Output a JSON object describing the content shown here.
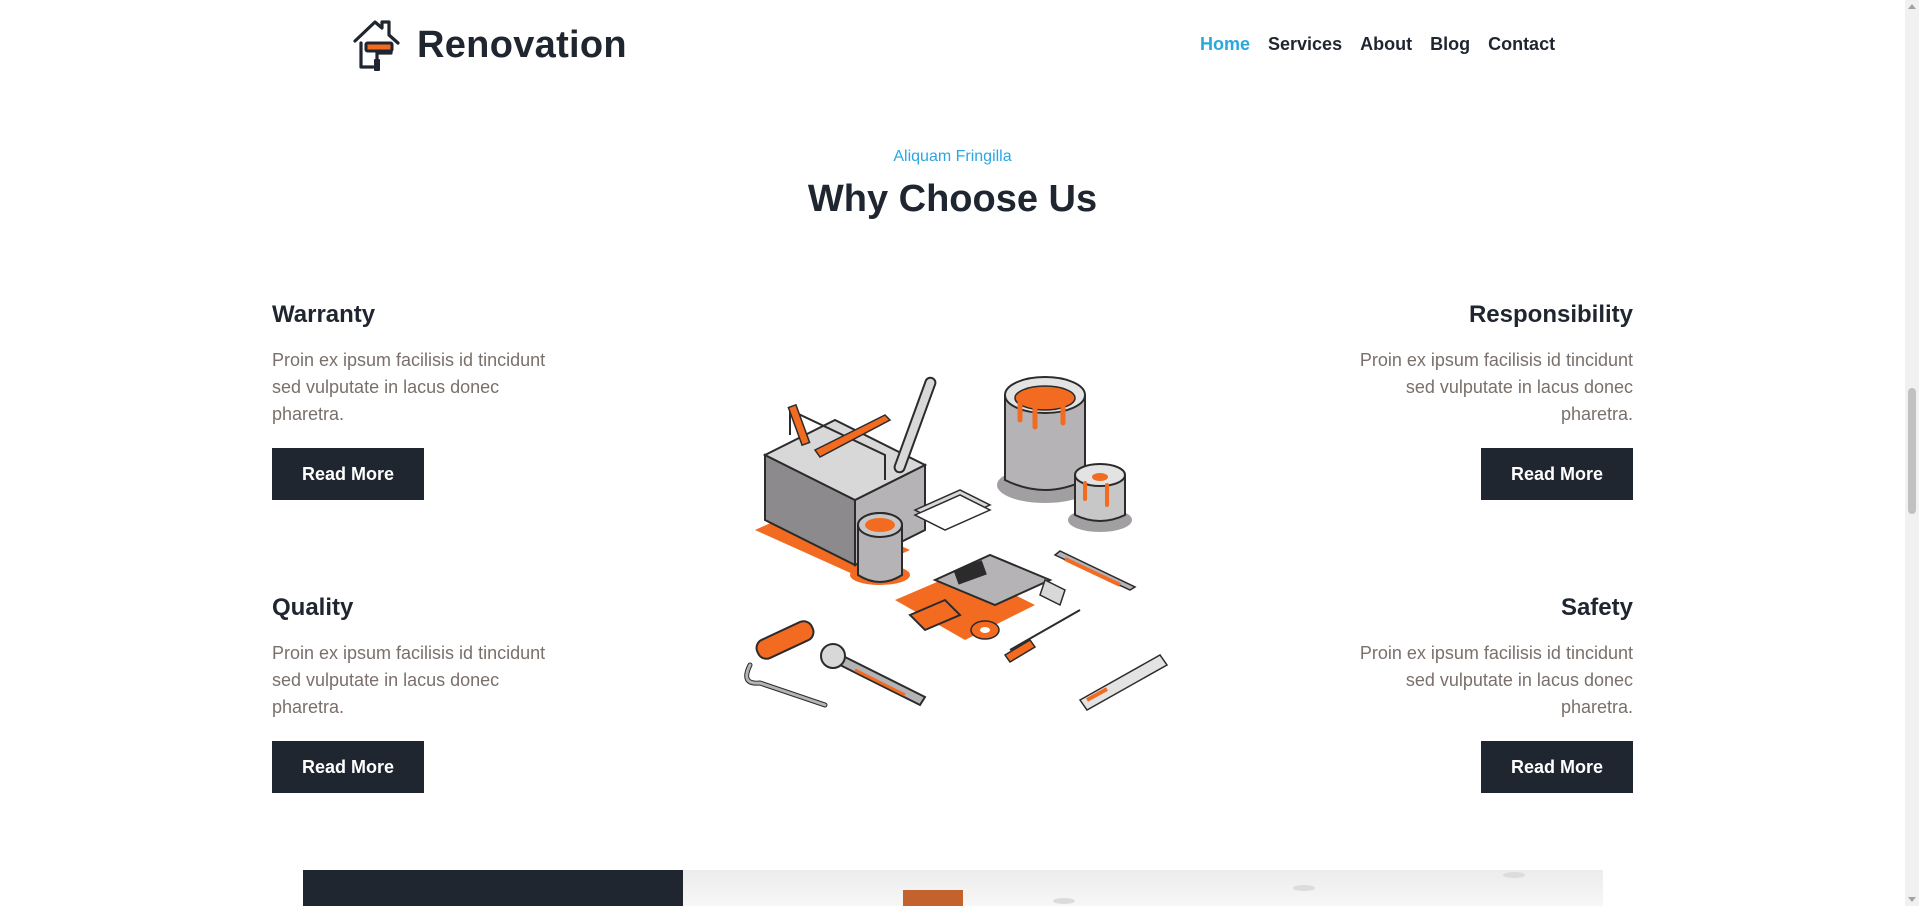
{
  "header": {
    "brand_name": "Renovation",
    "logo_icon": "house-paint-roller-icon",
    "nav": [
      {
        "label": "Home",
        "active": true
      },
      {
        "label": "Services",
        "active": false
      },
      {
        "label": "About",
        "active": false
      },
      {
        "label": "Blog",
        "active": false
      },
      {
        "label": "Contact",
        "active": false
      }
    ]
  },
  "section": {
    "eyebrow": "Aliquam Fringilla",
    "title": "Why Choose Us"
  },
  "features": [
    {
      "title": "Warranty",
      "text": "Proin ex ipsum facilisis id tincidunt sed vulputate in lacus donec pharetra.",
      "button": "Read More"
    },
    {
      "title": "Responsibility",
      "text": "Proin ex ipsum facilisis id tincidunt sed vulputate in lacus donec pharetra.",
      "button": "Read More"
    },
    {
      "title": "Quality",
      "text": "Proin ex ipsum facilisis id tincidunt sed vulputate in lacus donec pharetra.",
      "button": "Read More"
    },
    {
      "title": "Safety",
      "text": "Proin ex ipsum facilisis id tincidunt sed vulputate in lacus donec pharetra.",
      "button": "Read More"
    }
  ],
  "illustration": {
    "icon": "renovation-tools-illustration"
  },
  "colors": {
    "accent": "#2aa7df",
    "dark": "#1f2630",
    "body_text": "#7a706b",
    "tool_orange": "#f26b21",
    "tool_gray": "#8c8a8c"
  }
}
